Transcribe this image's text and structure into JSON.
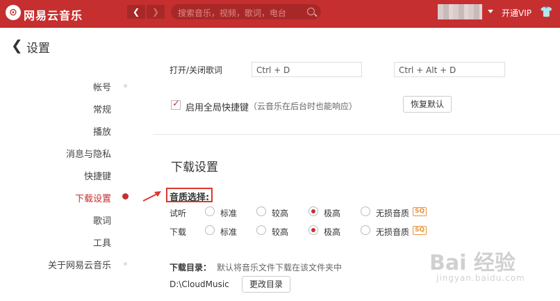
{
  "topbar": {
    "app_name": "网易云音乐",
    "logo_glyph": "⊙",
    "back_glyph": "❮",
    "forward_glyph": "❯",
    "search_placeholder": "搜索音乐，视频，歌词，电台",
    "vip_label": "开通VIP",
    "skin_glyph": "👕",
    "accent_color": "#c62f2f"
  },
  "header": {
    "back_glyph": "❮",
    "title": "设置"
  },
  "sidebar": {
    "items": [
      {
        "label": "帐号"
      },
      {
        "label": "常规"
      },
      {
        "label": "播放"
      },
      {
        "label": "消息与隐私"
      },
      {
        "label": "快捷键"
      },
      {
        "label": "下载设置",
        "active": true
      },
      {
        "label": "歌词"
      },
      {
        "label": "工具"
      },
      {
        "label": "关于网易云音乐"
      }
    ]
  },
  "shortcuts": {
    "row_label": "打开/关闭歌词",
    "local_key": "Ctrl + D",
    "global_key": "Ctrl + Alt + D",
    "global_enable_label": "启用全局快捷键",
    "global_enable_note": "（云音乐在后台时也能响应）",
    "global_enabled": true,
    "restore_button": "恢复默认"
  },
  "download": {
    "section_title": "下载设置",
    "quality_label": "音质选择:",
    "quality_options": [
      "标准",
      "较高",
      "极高",
      "无损音质"
    ],
    "sq_badge": "SQ",
    "preview_label": "试听",
    "preview_selected": "极高",
    "download_label": "下载",
    "download_selected": "极高",
    "dir_label": "下载目录：",
    "dir_hint": "默认将音乐文件下载在该文件夹中",
    "dir_path": "D:\\CloudMusic",
    "change_dir_button": "更改目录"
  },
  "watermark": {
    "text": "Bai 经验",
    "sub": "jingyan.baidu.com"
  }
}
